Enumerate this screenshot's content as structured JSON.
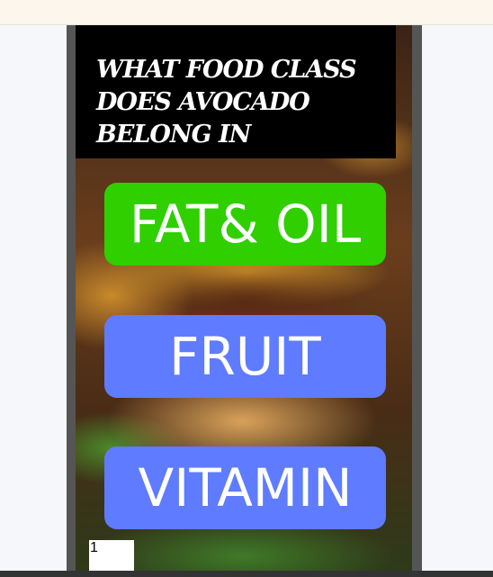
{
  "quiz": {
    "question": "WHAT FOOD CLASS DOES AVOCADO BELONG IN",
    "answers": [
      "FAT& OIL",
      "FRUIT",
      "VITAMIN"
    ],
    "counter": "1"
  },
  "colors": {
    "correct_answer": "#2fcf00",
    "answer": "#5f7bff",
    "question_bg": "#000000",
    "frame": "#555555"
  },
  "icons": [
    "flag-icon"
  ]
}
